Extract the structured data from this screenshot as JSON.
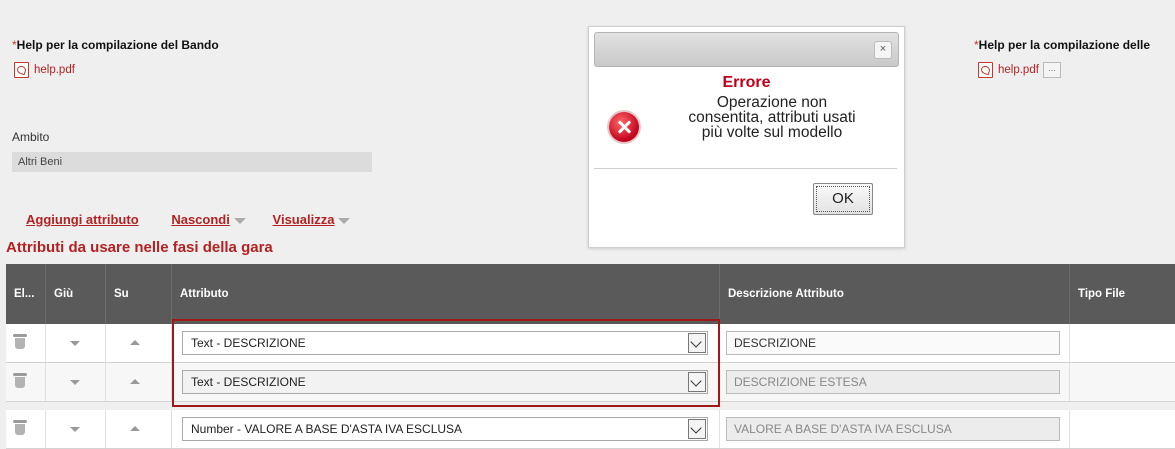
{
  "left_panel": {
    "help_label_star": "*",
    "help_label": "Help per la compilazione del Bando",
    "help_file": "help.pdf",
    "ambito_label": "Ambito",
    "ambito_value": "Altri Beni"
  },
  "right_panel": {
    "help_label_star": "*",
    "help_label": "Help per la compilazione delle",
    "help_file": "help.pdf",
    "ellipsis": "..."
  },
  "toolbar": {
    "add_attribute": "Aggiungi attributo",
    "hide": "Nascondi",
    "view": "Visualizza"
  },
  "section_title": "Attributi da usare nelle fasi della gara",
  "table": {
    "headers": [
      "El...",
      "Giù",
      "Su",
      "Attributo",
      "Descrizione Attributo",
      "Tipo File"
    ],
    "rows": [
      {
        "attribute": "Text - DESCRIZIONE",
        "description": "DESCRIZIONE"
      },
      {
        "attribute": "Text - DESCRIZIONE",
        "description": "DESCRIZIONE ESTESA"
      },
      {
        "attribute": "Number - VALORE A BASE D'ASTA IVA ESCLUSA",
        "description": "VALORE A BASE D'ASTA IVA ESCLUSA"
      }
    ]
  },
  "dialog": {
    "close_symbol": "×",
    "title": "Errore",
    "message_line1": "Operazione non",
    "message_line2": "consentita, attributi usati",
    "message_line3": "più volte sul modello",
    "ok_label": "OK"
  },
  "colors": {
    "accent_red": "#b22222",
    "header_bg": "#5a5a5a",
    "error_red": "#c0001b"
  }
}
